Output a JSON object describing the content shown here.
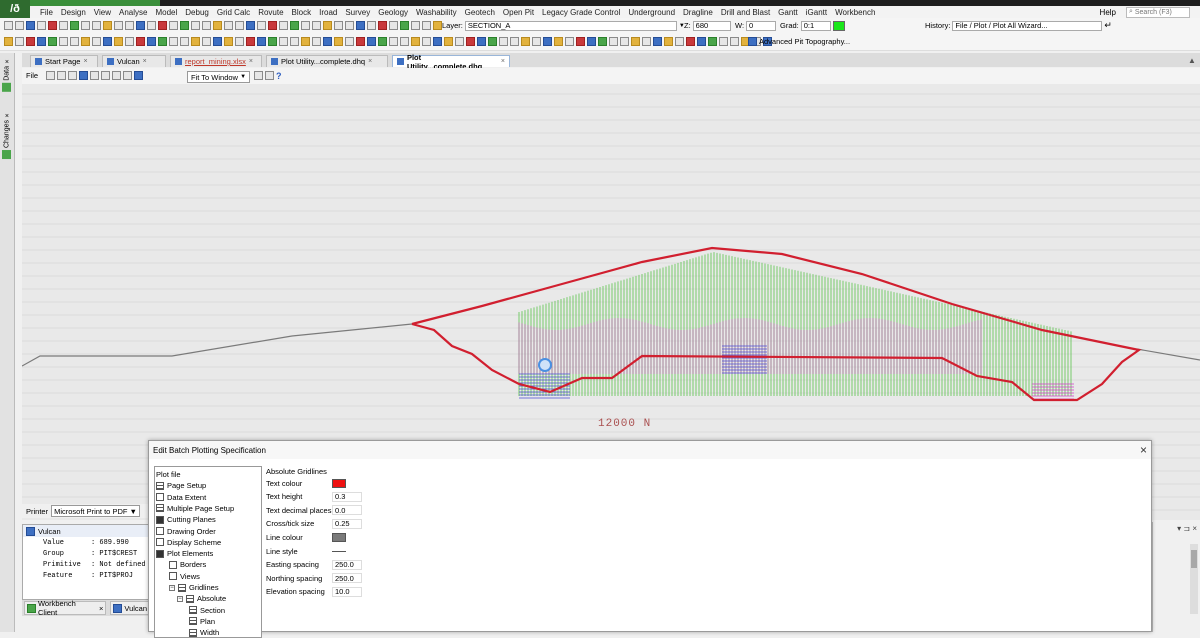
{
  "app": {
    "logo_text": "/ð"
  },
  "menu": {
    "items": [
      "File",
      "Design",
      "View",
      "Analyse",
      "Model",
      "Debug",
      "Grid Calc",
      "Rovute",
      "Block",
      "Iroad",
      "Survey",
      "Geology",
      "Washability",
      "Geotech",
      "Open Pit",
      "Legacy Grade Control",
      "Underground",
      "Dragline",
      "Drill and Blast",
      "Gantt",
      "iGantt",
      "Workbench"
    ],
    "help": "Help",
    "search_placeholder": "Search (F3)"
  },
  "toolbar1": {
    "layer_label": "Layer:",
    "layer_value": "SECTION_A",
    "z_label": "Z:",
    "z_value": "680",
    "w_label": "W:",
    "w_value": "0",
    "grad_label": "Grad:",
    "grad_value": "0:1",
    "grad_color": "#19e619",
    "history_label": "History:",
    "history_value": "File / Plot / Plot All Wizard..."
  },
  "toolbar2": {
    "topography_label": "Advanced Pit Topography..."
  },
  "tabs": [
    {
      "label": "Start Page",
      "active": false
    },
    {
      "label": "Vulcan",
      "active": false
    },
    {
      "label": "report_mining.xlsx",
      "active": false
    },
    {
      "label": "Plot Utility...complete.dhq",
      "active": false
    },
    {
      "label": "Plot Utility...complete.dhq",
      "active": true
    }
  ],
  "viewbar": {
    "file_label": "File",
    "fit_label": "Fit To Window"
  },
  "side_tabs": {
    "data": "Data",
    "changes": "Changes"
  },
  "canvas": {
    "section_label": "12000  N",
    "surface_color": "#7a7a7a",
    "outline_color": "#d11f2f",
    "fill_green": "#4bbf3a",
    "fill_magenta": "#d23cc8",
    "fill_blue": "#4a4ad6"
  },
  "printer": {
    "label": "Printer",
    "value": "Microsoft Print to PDF"
  },
  "vulcan_panel": {
    "title": "Vulcan",
    "properties": [
      {
        "key": "Value",
        "value": ": 689.990"
      },
      {
        "key": "Group",
        "value": ": PIT$CREST"
      },
      {
        "key": "Primitive",
        "value": ": Not defined"
      },
      {
        "key": "Feature",
        "value": ": PIT$PROJ"
      }
    ]
  },
  "bottom_tabs": [
    "Workbench Client",
    "Vulcan"
  ],
  "dialog": {
    "title": "Edit Batch Plotting Specification",
    "tree": [
      {
        "label": "Plot file",
        "level": 0
      },
      {
        "label": "Page Setup",
        "level": 1
      },
      {
        "label": "Data Extent",
        "level": 1
      },
      {
        "label": "Multiple Page Setup",
        "level": 1
      },
      {
        "label": "Cutting Planes",
        "level": 1
      },
      {
        "label": "Drawing Order",
        "level": 1
      },
      {
        "label": "Display Scheme",
        "level": 1
      },
      {
        "label": "Plot Elements",
        "level": 1
      },
      {
        "label": "Borders",
        "level": 2
      },
      {
        "label": "Views",
        "level": 2
      },
      {
        "label": "Gridlines",
        "level": 2
      },
      {
        "label": "Absolute",
        "level": 3
      },
      {
        "label": "Section",
        "level": 4
      },
      {
        "label": "Plan",
        "level": 4
      },
      {
        "label": "Width",
        "level": 4
      }
    ],
    "section_heading": "Absolute Gridlines",
    "properties": [
      {
        "label": "Text colour",
        "value": "",
        "swatch": "#ee1111"
      },
      {
        "label": "Text height",
        "value": "0.3"
      },
      {
        "label": "Text decimal places",
        "value": "0.0"
      },
      {
        "label": "Cross/tick size",
        "value": "0.25"
      },
      {
        "label": "Line colour",
        "value": "",
        "swatch": "#7a7a7a"
      },
      {
        "label": "Line style",
        "value": "",
        "line": true
      },
      {
        "label": "Easting spacing",
        "value": "250.0"
      },
      {
        "label": "Northing spacing",
        "value": "250.0"
      },
      {
        "label": "Elevation spacing",
        "value": "10.0"
      }
    ]
  }
}
